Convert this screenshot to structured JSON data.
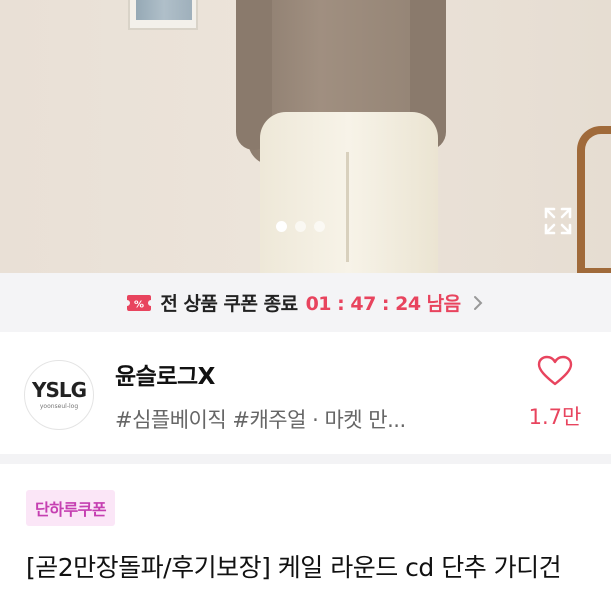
{
  "gallery": {
    "dots_total": 3,
    "active_dot": 1
  },
  "coupon_bar": {
    "label": "전 상품 쿠폰 종료",
    "countdown": "01 : 47 : 24 남음"
  },
  "shop": {
    "logo_text": "YSLG",
    "logo_subtext": "yoonseul-log",
    "name": "윤슬로그X",
    "tags": "#심플베이직 #캐주얼 · 마켓 만...",
    "like_count": "1.7만"
  },
  "product": {
    "badge": "단하루쿠폰",
    "title": "[곧2만장돌파/후기보장] 케일 라운드 cd 단추 가디건"
  },
  "colors": {
    "accent": "#e8445e",
    "badge_bg": "#fbe6f7",
    "badge_text": "#c53fb1"
  }
}
